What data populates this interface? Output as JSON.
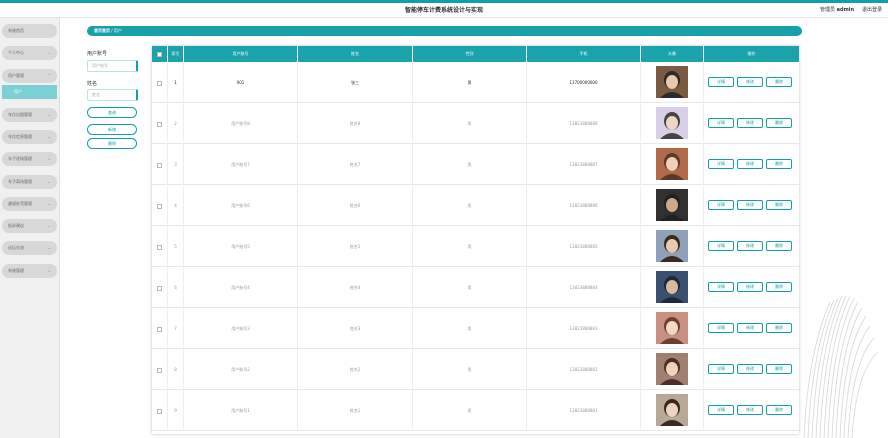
{
  "header": {
    "title": "智能停车计费系统设计与实现",
    "admin_prefix": "管理员",
    "admin_name": "admin",
    "logout": "退出登录"
  },
  "sidebar": {
    "items": [
      {
        "label": "系统首页"
      },
      {
        "label": "个人中心"
      },
      {
        "label": "用户管理"
      },
      {
        "label": "车位出租管理"
      },
      {
        "label": "车位信息管理"
      },
      {
        "label": "车子进场管理"
      },
      {
        "label": "车子离场管理"
      },
      {
        "label": "違规处罚管理"
      },
      {
        "label": "投诉建议"
      },
      {
        "label": "论坛交流"
      },
      {
        "label": "系统管理"
      }
    ],
    "submenu": {
      "label": "用户"
    }
  },
  "breadcrumb": {
    "home": "首页首页",
    "separator": "/",
    "current": "用户"
  },
  "filters": {
    "account_label": "用户账号",
    "account_placeholder": "用户账号",
    "name_label": "姓名",
    "name_placeholder": "姓名",
    "query_button": "查询",
    "add_button": "新增",
    "delete_button": "删除"
  },
  "table": {
    "headers": [
      "",
      "索引",
      "用户账号",
      "姓名",
      "性别",
      "手机",
      "头像",
      "操作"
    ],
    "row_buttons": [
      "详情",
      "修改",
      "删除"
    ],
    "rows": [
      {
        "index": "1",
        "account": "001",
        "name": "张三",
        "gender": "男",
        "phone": "13700000000"
      },
      {
        "index": "2",
        "account": "用户账号8",
        "name": "姓名8",
        "gender": "男",
        "phone": "13823888888"
      },
      {
        "index": "3",
        "account": "用户账号7",
        "name": "姓名7",
        "gender": "男",
        "phone": "13823888887"
      },
      {
        "index": "4",
        "account": "用户账号6",
        "name": "姓名6",
        "gender": "男",
        "phone": "13823888886"
      },
      {
        "index": "5",
        "account": "用户账号5",
        "name": "姓名5",
        "gender": "男",
        "phone": "13823888885"
      },
      {
        "index": "6",
        "account": "用户账号4",
        "name": "姓名4",
        "gender": "男",
        "phone": "13823888884"
      },
      {
        "index": "7",
        "account": "用户账号3",
        "name": "姓名3",
        "gender": "男",
        "phone": "13823888883"
      },
      {
        "index": "8",
        "account": "用户账号2",
        "name": "姓名2",
        "gender": "男",
        "phone": "13823888882"
      },
      {
        "index": "9",
        "account": "用户账号1",
        "name": "姓名1",
        "gender": "男",
        "phone": "13823888881"
      }
    ]
  },
  "colors": {
    "accent": "#0fa0a8",
    "table_header": "#1aa3ab",
    "submenu_active": "#7ccfd4",
    "sidebar_bg": "#f0f0f0"
  }
}
